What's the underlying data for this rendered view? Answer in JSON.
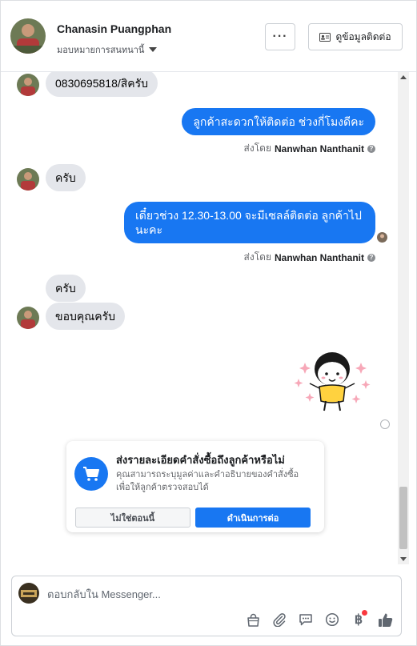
{
  "header": {
    "contact_name": "Chanasin Puangphan",
    "assign_label": "มอบหมายการสนทนานี้",
    "more_label": "···",
    "info_button_label": "ดูข้อมูลติดต่อ"
  },
  "messages": [
    {
      "direction": "in",
      "text": "0830695818/สิครับ"
    },
    {
      "direction": "out",
      "text": "ลูกค้าสะดวกให้ติดต่อ ช่วงกี่โมงดีคะ"
    },
    {
      "direction": "in",
      "text": "ครับ"
    },
    {
      "direction": "out",
      "text": "เดี๋ยวช่วง 12.30-13.00 จะมีเซลล์ติดต่อ ลูกค้าไป นะคะ"
    },
    {
      "direction": "in",
      "text": "ครับ"
    },
    {
      "direction": "in",
      "text": "ขอบคุณครับ"
    }
  ],
  "sent_by": {
    "prefix": "ส่งโดย",
    "name": "Nanwhan Nanthanit",
    "help_glyph": "?"
  },
  "order_card": {
    "title": "ส่งรายละเอียดคำสั่งซื้อถึงลูกค้าหรือไม่",
    "description": "คุณสามารถระบุมูลค่าและคำอธิบายของคำสั่งซื้อ เพื่อให้ลูกค้าตรวจสอบได้",
    "decline_label": "ไม่ใช่ตอนนี้",
    "accept_label": "ดำเนินการต่อ"
  },
  "composer": {
    "placeholder": "ตอบกลับใน Messenger...",
    "baht_symbol": "฿"
  },
  "colors": {
    "accent": "#1877f2",
    "incoming_bubble": "#e4e6eb",
    "notification_dot": "#fa383e"
  },
  "icons": [
    "more-options-icon",
    "contact-card-icon",
    "cart-icon",
    "bag-icon",
    "paperclip-icon",
    "chat-bubble-icon",
    "smiley-icon",
    "baht-icon",
    "thumbs-up-icon",
    "help-icon",
    "seen-icon"
  ]
}
